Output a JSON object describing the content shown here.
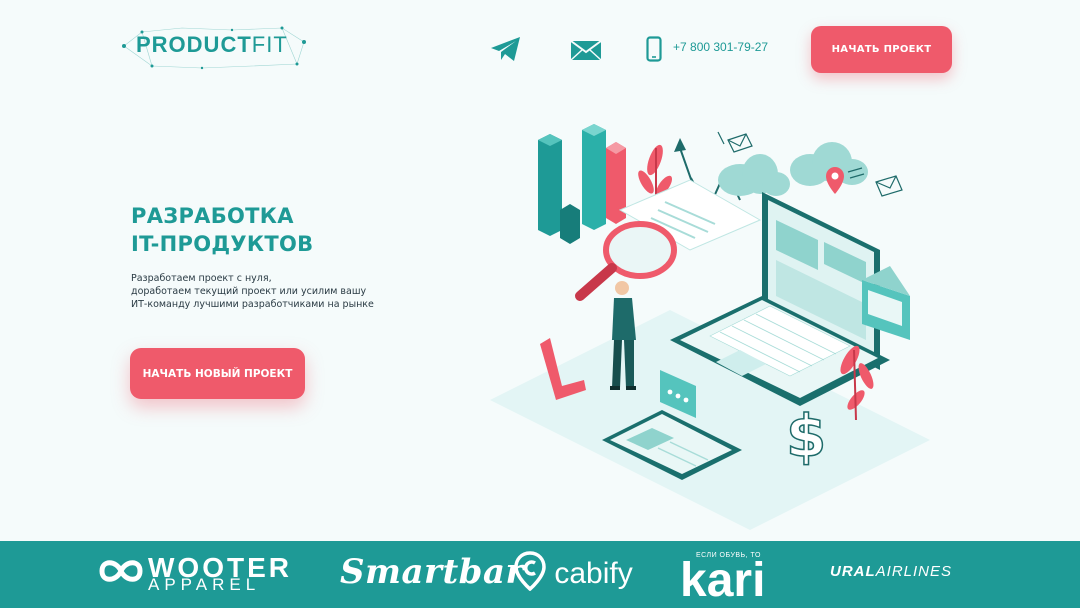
{
  "header": {
    "logo_bold": "PRODUCT",
    "logo_light": "FIT",
    "phone": "+7 800 301-79-27",
    "cta": "НАЧАТЬ ПРОЕКТ",
    "icons": [
      "telegram-icon",
      "mail-icon",
      "phone-icon"
    ]
  },
  "hero": {
    "title_line1": "РАЗРАБОТКА",
    "title_line2": "IT-ПРОДУКТОВ",
    "subtitle_line1": "Разработаем проект с нуля,",
    "subtitle_line2": "доработаем текущий проект или усилим вашу",
    "subtitle_line3": "ИТ-команду лучшими разработчиками на рынке",
    "cta": "НАЧАТЬ НОВЫЙ ПРОЕКТ"
  },
  "clients": {
    "wooter_word": "WOOTER",
    "wooter_sub": "APPAREL",
    "smartbar": "Smartbar",
    "cabify": "cabify",
    "kari_tag": "ЕСЛИ ОБУВЬ, ТО",
    "kari": "kari",
    "ural_bold": "URAL",
    "ural_light": "AIRLINES"
  },
  "colors": {
    "accent": "#1e9a96",
    "cta": "#ef5a6b",
    "background": "#f5fbfb"
  }
}
